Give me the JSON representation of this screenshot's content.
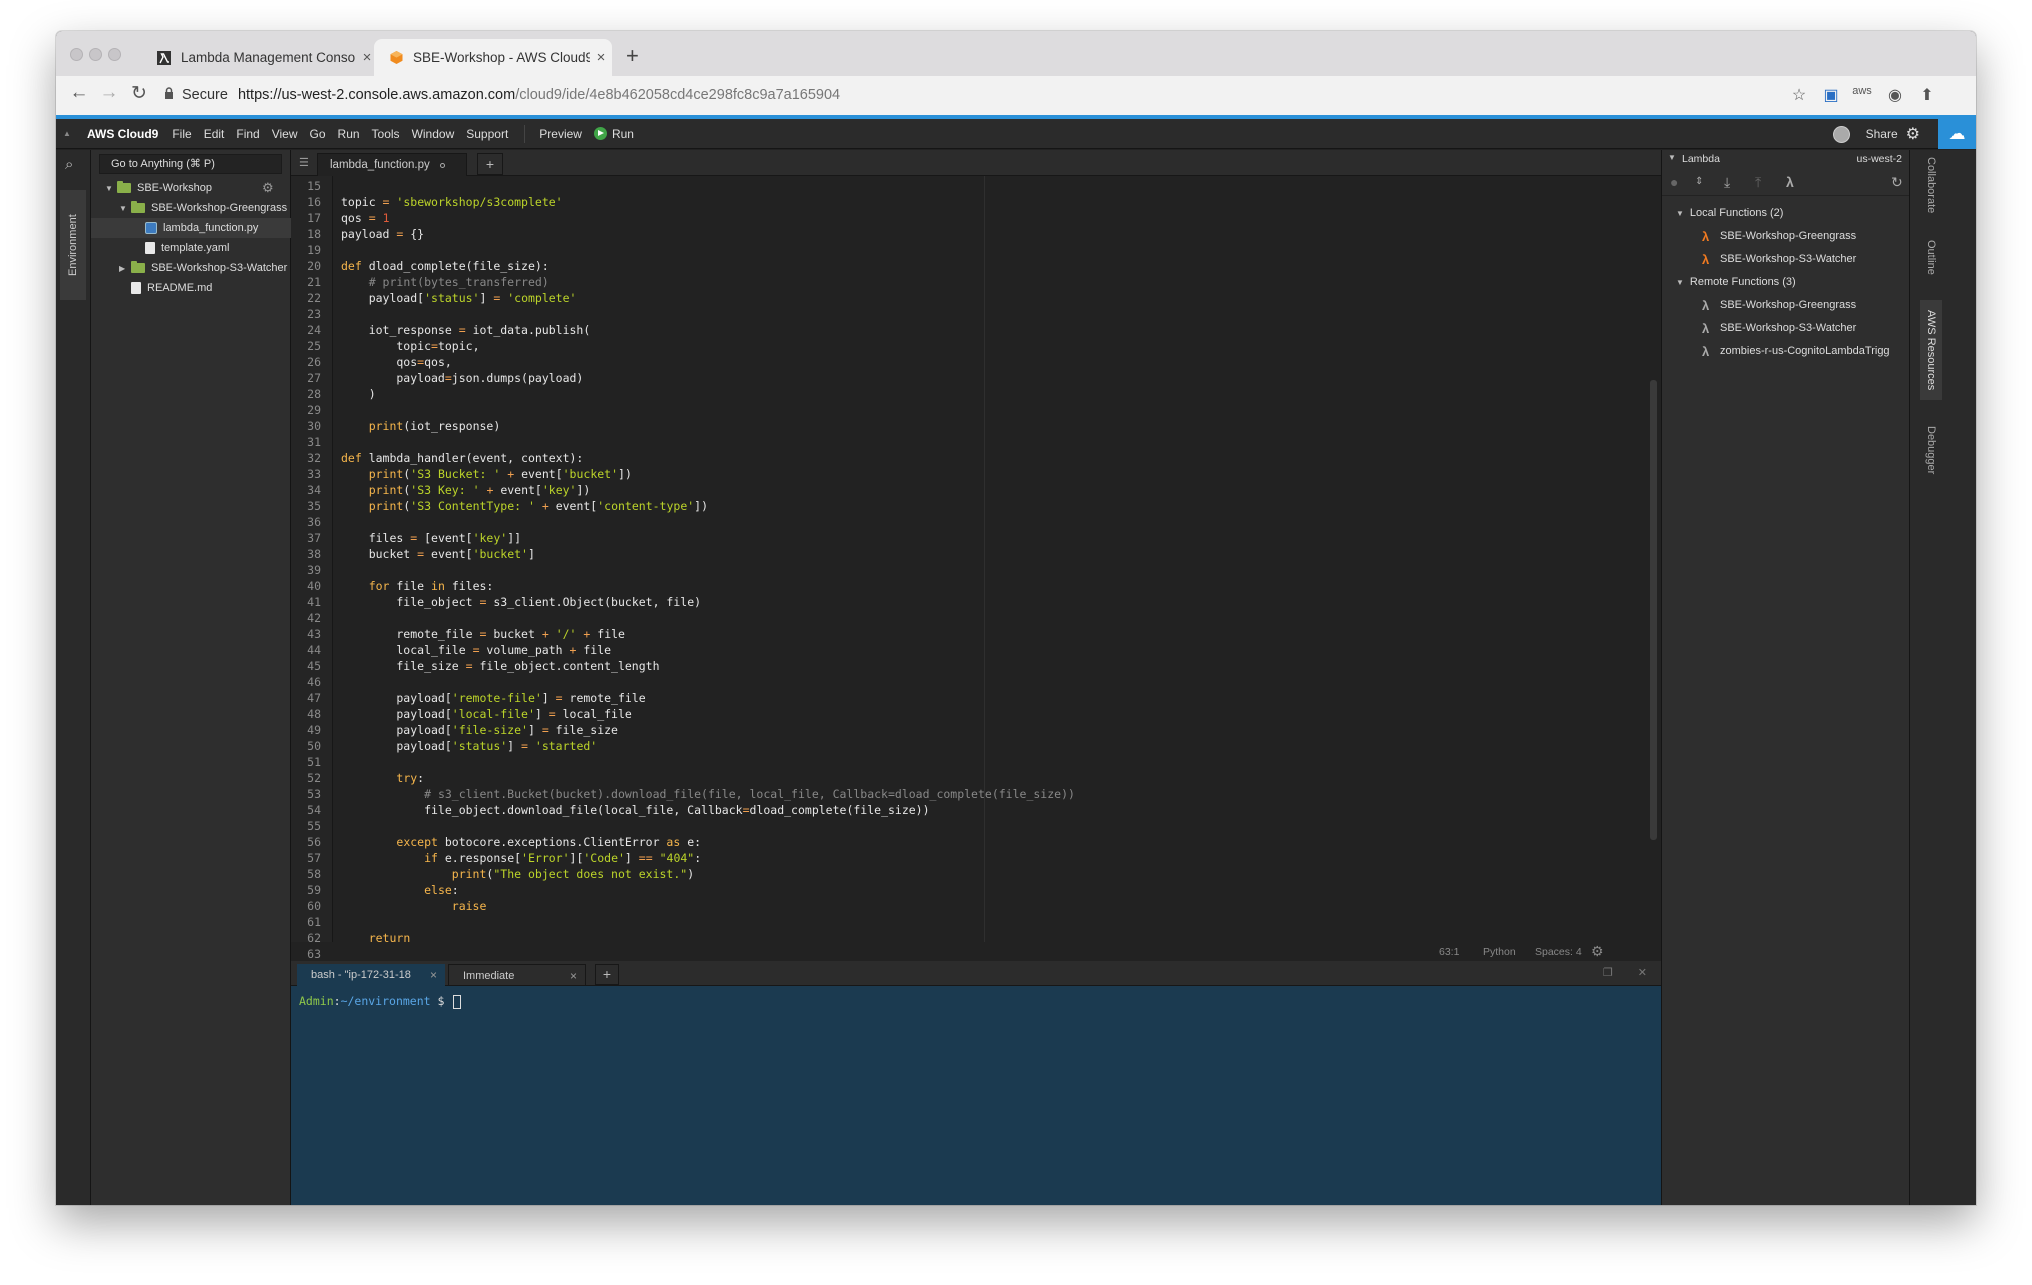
{
  "browser": {
    "tabs": [
      {
        "title": "Lambda Management Console",
        "active": false
      },
      {
        "title": "SBE-Workshop - AWS Cloud9",
        "active": true
      }
    ],
    "secure_label": "Secure",
    "url_host": "https://us-west-2.console.aws.amazon.com",
    "url_path": "/cloud9/ide/4e8b462058cd4ce298fc8c9a7a165904"
  },
  "menubar": {
    "brand": "AWS Cloud9",
    "items": [
      "File",
      "Edit",
      "Find",
      "View",
      "Go",
      "Run",
      "Tools",
      "Window",
      "Support"
    ],
    "preview": "Preview",
    "run": "Run",
    "share": "Share"
  },
  "environment": {
    "tab_label": "Environment",
    "goto_placeholder": "Go to Anything (⌘ P)",
    "tree": [
      {
        "label": "SBE-Workshop",
        "type": "folder",
        "depth": 0,
        "expanded": true
      },
      {
        "label": "SBE-Workshop-Greengrass",
        "type": "folder",
        "depth": 1,
        "expanded": true
      },
      {
        "label": "lambda_function.py",
        "type": "py",
        "depth": 2
      },
      {
        "label": "template.yaml",
        "type": "file",
        "depth": 2
      },
      {
        "label": "SBE-Workshop-S3-Watcher",
        "type": "folder",
        "depth": 1,
        "expanded": false
      },
      {
        "label": "README.md",
        "type": "file",
        "depth": 1
      }
    ]
  },
  "editor": {
    "tab_label": "lambda_function.py",
    "first_line": 15,
    "lines": [
      "",
      "topic = 'sbeworkshop/s3complete'",
      "qos = 1",
      "payload = {}",
      "",
      "def dload_complete(file_size):",
      "    # print(bytes_transferred)",
      "    payload['status'] = 'complete'",
      "",
      "    iot_response = iot_data.publish(",
      "        topic=topic,",
      "        qos=qos,",
      "        payload=json.dumps(payload)",
      "    )",
      "",
      "    print(iot_response)",
      "",
      "def lambda_handler(event, context):",
      "    print('S3 Bucket: ' + event['bucket'])",
      "    print('S3 Key: ' + event['key'])",
      "    print('S3 ContentType: ' + event['content-type'])",
      "",
      "    files = [event['key']]",
      "    bucket = event['bucket']",
      "",
      "    for file in files:",
      "        file_object = s3_client.Object(bucket, file)",
      "",
      "        remote_file = bucket + '/' + file",
      "        local_file = volume_path + file",
      "        file_size = file_object.content_length",
      "",
      "        payload['remote-file'] = remote_file",
      "        payload['local-file'] = local_file",
      "        payload['file-size'] = file_size",
      "        payload['status'] = 'started'",
      "",
      "        try:",
      "            # s3_client.Bucket(bucket).download_file(file, local_file, Callback=dload_complete(file_size))",
      "            file_object.download_file(local_file, Callback=dload_complete(file_size))",
      "",
      "        except botocore.exceptions.ClientError as e:",
      "            if e.response['Error']['Code'] == \"404\":",
      "                print(\"The object does not exist.\")",
      "            else:",
      "                raise",
      "",
      "    return",
      ""
    ],
    "status": {
      "position": "63:1",
      "language": "Python",
      "spaces": "Spaces: 4"
    }
  },
  "terminal": {
    "tabs": [
      "bash - \"ip-172-31-18",
      "Immediate"
    ],
    "prompt_user": "Admin",
    "prompt_path": "~/environment",
    "prompt_symbol": "$"
  },
  "lambda_panel": {
    "title": "Lambda",
    "region": "us-west-2",
    "local_header": "Local Functions (2)",
    "local": [
      "SBE-Workshop-Greengrass",
      "SBE-Workshop-S3-Watcher"
    ],
    "remote_header": "Remote Functions (3)",
    "remote": [
      "SBE-Workshop-Greengrass",
      "SBE-Workshop-S3-Watcher",
      "zombies-r-us-CognitoLambdaTrigg"
    ]
  },
  "right_tabs": [
    "Collaborate",
    "Outline",
    "AWS Resources",
    "Debugger"
  ],
  "colors": {
    "accent": "#2a90d8",
    "editor_bg": "#222222",
    "terminal_bg": "#1b3a50",
    "keyword": "#f6b64c",
    "string": "#bcd42a",
    "lambda_local": "#f07a21"
  }
}
